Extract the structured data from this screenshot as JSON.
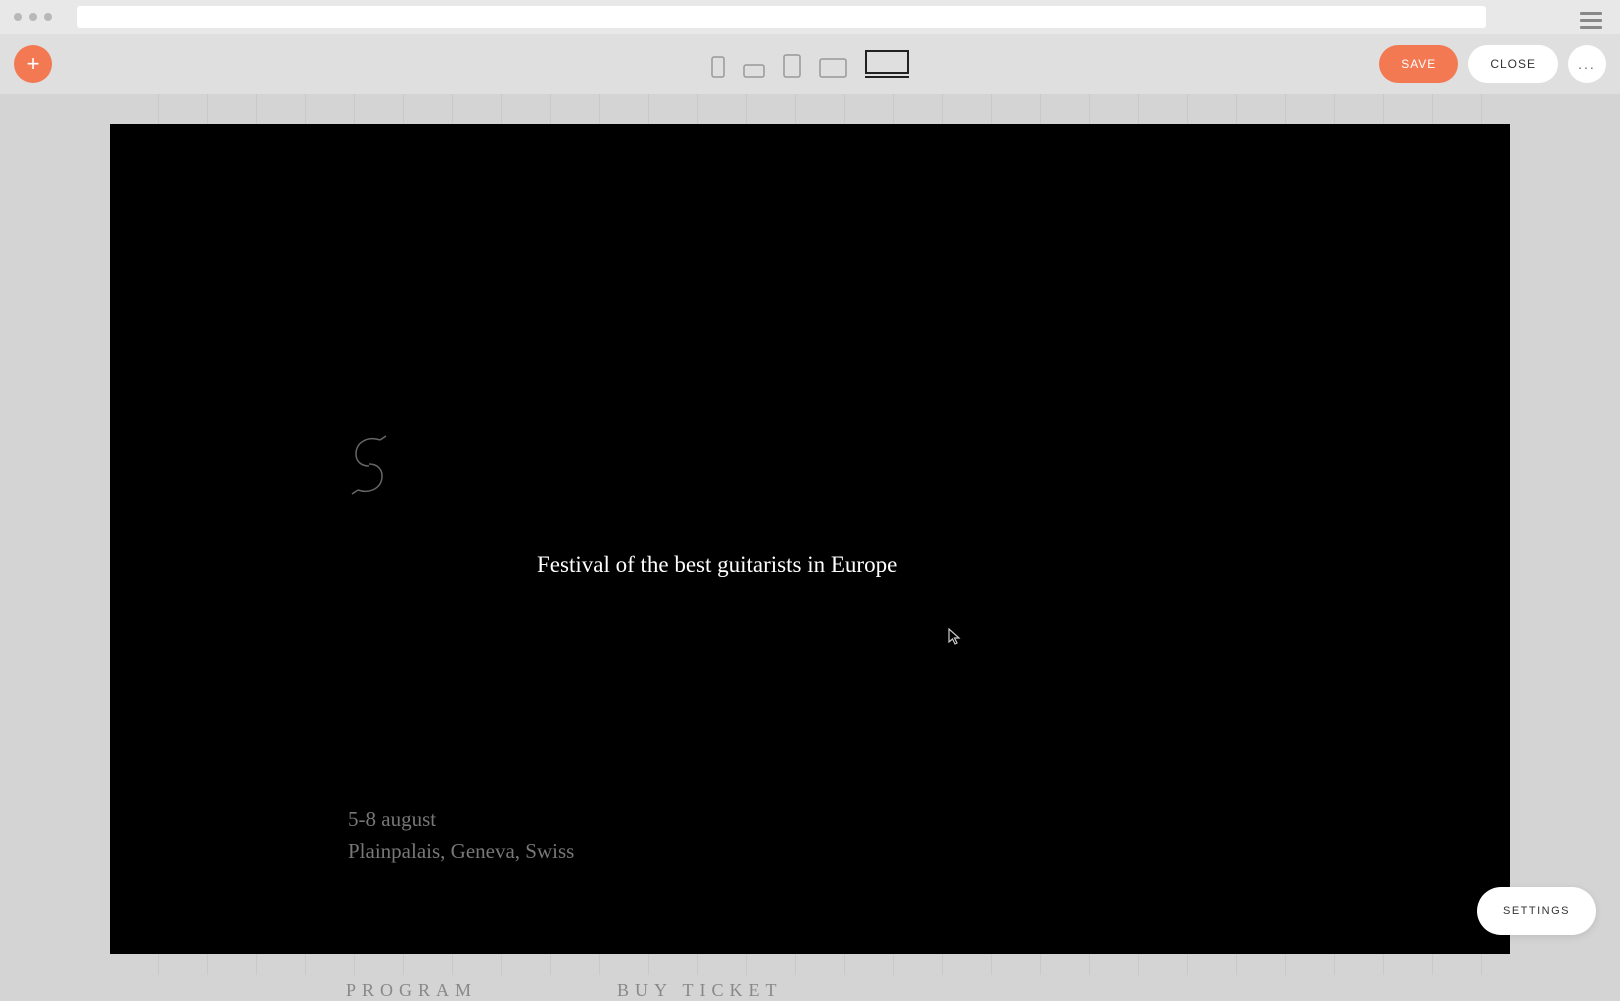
{
  "toolbar": {
    "add_label": "+",
    "save_label": "SAVE",
    "close_label": "CLOSE",
    "more_label": "...",
    "devices": {
      "phone_portrait": "phone-portrait",
      "phone_landscape": "phone-landscape",
      "tablet_portrait": "tablet-portrait",
      "tablet_landscape": "tablet-landscape",
      "desktop": "desktop"
    }
  },
  "page": {
    "title": "Festival of the best guitarists in Europe",
    "date": "5-8 august",
    "location": "Plainpalais, Geneva, Swiss",
    "link_program": "PROGRAM",
    "link_ticket": "BUY TICKET"
  },
  "settings_label": "SETTINGS",
  "colors": {
    "accent": "#f27952",
    "canvas_bg": "#000000"
  }
}
